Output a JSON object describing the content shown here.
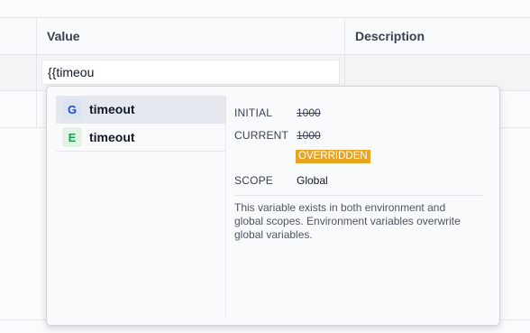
{
  "table": {
    "columns": [
      {
        "label": ""
      },
      {
        "label": "Value"
      },
      {
        "label": "Description"
      }
    ],
    "value_input": "{{timeou"
  },
  "autocomplete": {
    "items": [
      {
        "badge": "G",
        "label": "timeout",
        "scope": "global",
        "active": true
      },
      {
        "badge": "E",
        "label": "timeout",
        "scope": "environment",
        "active": false
      }
    ],
    "details": {
      "initial_key": "INITIAL",
      "initial_value": "1000",
      "current_key": "CURRENT",
      "current_value": "1000",
      "overridden_label": "OVERRIDDEN",
      "scope_key": "SCOPE",
      "scope_value": "Global",
      "description": "This variable exists in both environment and global scopes. Environment variables overwrite global variables."
    }
  },
  "colors": {
    "overridden_chip": "#e8a521",
    "global_badge": "#1d4ed8",
    "environment_badge": "#16a34a"
  }
}
